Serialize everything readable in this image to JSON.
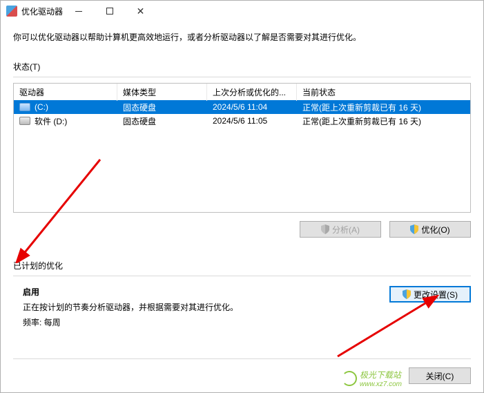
{
  "titlebar": {
    "title": "优化驱动器"
  },
  "intro": "你可以优化驱动器以帮助计算机更高效地运行，或者分析驱动器以了解是否需要对其进行优化。",
  "status_label": "状态(T)",
  "drive_table": {
    "headers": {
      "drive": "驱动器",
      "media": "媒体类型",
      "last": "上次分析或优化的...",
      "state": "当前状态"
    },
    "rows": [
      {
        "selected": true,
        "name": "(C:)",
        "media": "固态硬盘",
        "last": "2024/5/6 11:04",
        "state": "正常(距上次重新剪裁已有 16 天)"
      },
      {
        "selected": false,
        "name": "软件 (D:)",
        "media": "固态硬盘",
        "last": "2024/5/6 11:05",
        "state": "正常(距上次重新剪裁已有 16 天)"
      }
    ]
  },
  "buttons": {
    "analyze": "分析(A)",
    "optimize": "优化(O)",
    "change_settings": "更改设置(S)",
    "close": "关闭(C)"
  },
  "schedule": {
    "label": "已计划的优化",
    "enabled_title": "启用",
    "desc": "正在按计划的节奏分析驱动器，并根据需要对其进行优化。",
    "freq": "频率: 每周"
  },
  "watermark": {
    "main": "极光下载站",
    "sub": "www.xz7.com"
  }
}
